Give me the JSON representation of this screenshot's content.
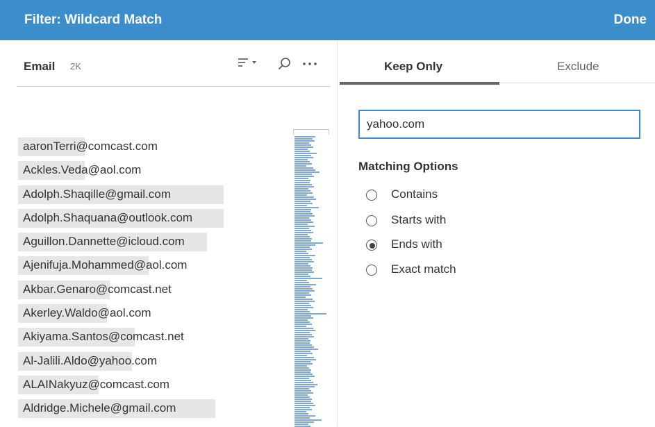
{
  "header": {
    "title": "Filter: Wildcard Match",
    "done_label": "Done"
  },
  "field": {
    "name": "Email",
    "count": "2K",
    "sort_icon": "sort-icon",
    "search_icon": "search-icon",
    "more_icon": "more-options-icon",
    "values": [
      {
        "text": "aaronTerri@comcast.com",
        "highlight": 0.24
      },
      {
        "text": "Ackles.Veda@aol.com",
        "highlight": 0.24
      },
      {
        "text": "Adolph.Shaqille@gmail.com",
        "highlight": 0.74
      },
      {
        "text": "Adolph.Shaquana@outlook.com",
        "highlight": 0.74
      },
      {
        "text": "Aguillon.Dannette@icloud.com",
        "highlight": 0.68
      },
      {
        "text": "Ajenifuja.Mohammed@aol.com",
        "highlight": 0.47
      },
      {
        "text": "Akbar.Genaro@comcast.net",
        "highlight": 0.33
      },
      {
        "text": "Akerley.Waldo@aol.com",
        "highlight": 0.32
      },
      {
        "text": "Akiyama.Santos@comcast.net",
        "highlight": 0.42
      },
      {
        "text": "Al-Jalili.Aldo@yahoo.com",
        "highlight": 0.41
      },
      {
        "text": "ALAINakyuz@comcast.com",
        "highlight": 0.29
      },
      {
        "text": "Aldridge.Michele@gmail.com",
        "highlight": 0.71
      }
    ]
  },
  "tabs": {
    "keep_only": "Keep Only",
    "exclude": "Exclude"
  },
  "search": {
    "value": "yahoo.com"
  },
  "matching": {
    "title": "Matching Options",
    "options": [
      {
        "label": "Contains",
        "selected": false
      },
      {
        "label": "Starts with",
        "selected": false
      },
      {
        "label": "Ends with",
        "selected": true
      },
      {
        "label": "Exact match",
        "selected": false
      }
    ]
  },
  "colors": {
    "header_bg": "#3c8dcb",
    "accent": "#3b8ad2",
    "histogram": "#7fa9d4",
    "highlight": "#e6e6e6"
  }
}
